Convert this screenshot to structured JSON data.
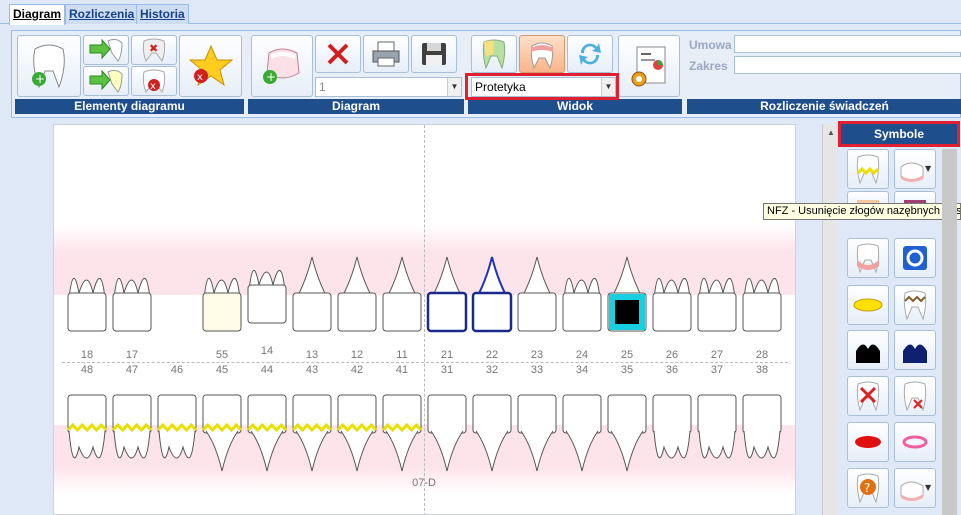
{
  "tabs": [
    {
      "label": "Diagram",
      "active": true
    },
    {
      "label": "Rozliczenia",
      "active": false
    },
    {
      "label": "Historia",
      "active": false
    }
  ],
  "toolbar": {
    "groups": {
      "elementy": "Elementy diagramu",
      "diagram": "Diagram",
      "widok": "Widok",
      "rozliczenie": "Rozliczenie świadczeń"
    },
    "diagram_select_value": "1",
    "widok_select_value": "Protetyka",
    "umowa_label": "Umowa",
    "zakres_label": "Zakres",
    "umowa_value": "",
    "zakres_value": ""
  },
  "diagram": {
    "upper_labels": [
      "18",
      "17",
      "",
      "55",
      "14",
      "13",
      "12",
      "11",
      "21",
      "22",
      "23",
      "24",
      "25",
      "26",
      "27",
      "28"
    ],
    "lower_labels": [
      "48",
      "47",
      "46",
      "45",
      "44",
      "43",
      "42",
      "41",
      "31",
      "32",
      "33",
      "34",
      "35",
      "36",
      "37",
      "38"
    ],
    "footer_label": "07-D"
  },
  "symbols": {
    "title": "Symbole",
    "tooltip": "NFZ - Usunięcie złogów nazębnych - usun"
  },
  "colors": {
    "accent": "#1f4e8c",
    "highlight": "#e02030",
    "gum": "#fde3ea",
    "selected_outline": "#1a2a8a",
    "cyan_frame": "#1ad0e0"
  }
}
